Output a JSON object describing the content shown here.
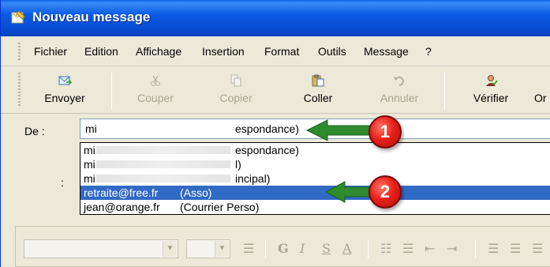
{
  "window": {
    "title": "Nouveau message"
  },
  "menu": [
    "Fichier",
    "Edition",
    "Affichage",
    "Insertion",
    "Format",
    "Outils",
    "Message",
    "?"
  ],
  "toolbar": {
    "send": "Envoyer",
    "cut": "Couper",
    "copy": "Copier",
    "paste": "Coller",
    "undo": "Annuler",
    "check": "Vérifier",
    "overflow": "Or"
  },
  "fields": {
    "from_label": "De :",
    "second_colon": ":",
    "from_value": "mi",
    "from_value_suffix": "espondance)"
  },
  "dropdown": [
    {
      "address": "mi",
      "label": "espondance)",
      "selected": false
    },
    {
      "address": "mi",
      "label": "l)",
      "selected": false
    },
    {
      "address": "mi",
      "label": "incipal)",
      "selected": false
    },
    {
      "address": "retraite@free.fr",
      "label": "(Asso)",
      "selected": true
    },
    {
      "address": "jean@orange.fr",
      "label": "(Courrier Perso)",
      "selected": false
    }
  ],
  "annotations": {
    "badge1": "1",
    "badge2": "2"
  },
  "formatbar": {
    "bold": "G",
    "italic": "I",
    "underline": "S",
    "color": "A"
  },
  "colors": {
    "titlebar": "#0a5ae6",
    "selection": "#316ac5",
    "arrow": "#2e8b2e",
    "badge": "#e8201a",
    "chrome": "#ece9d8"
  }
}
